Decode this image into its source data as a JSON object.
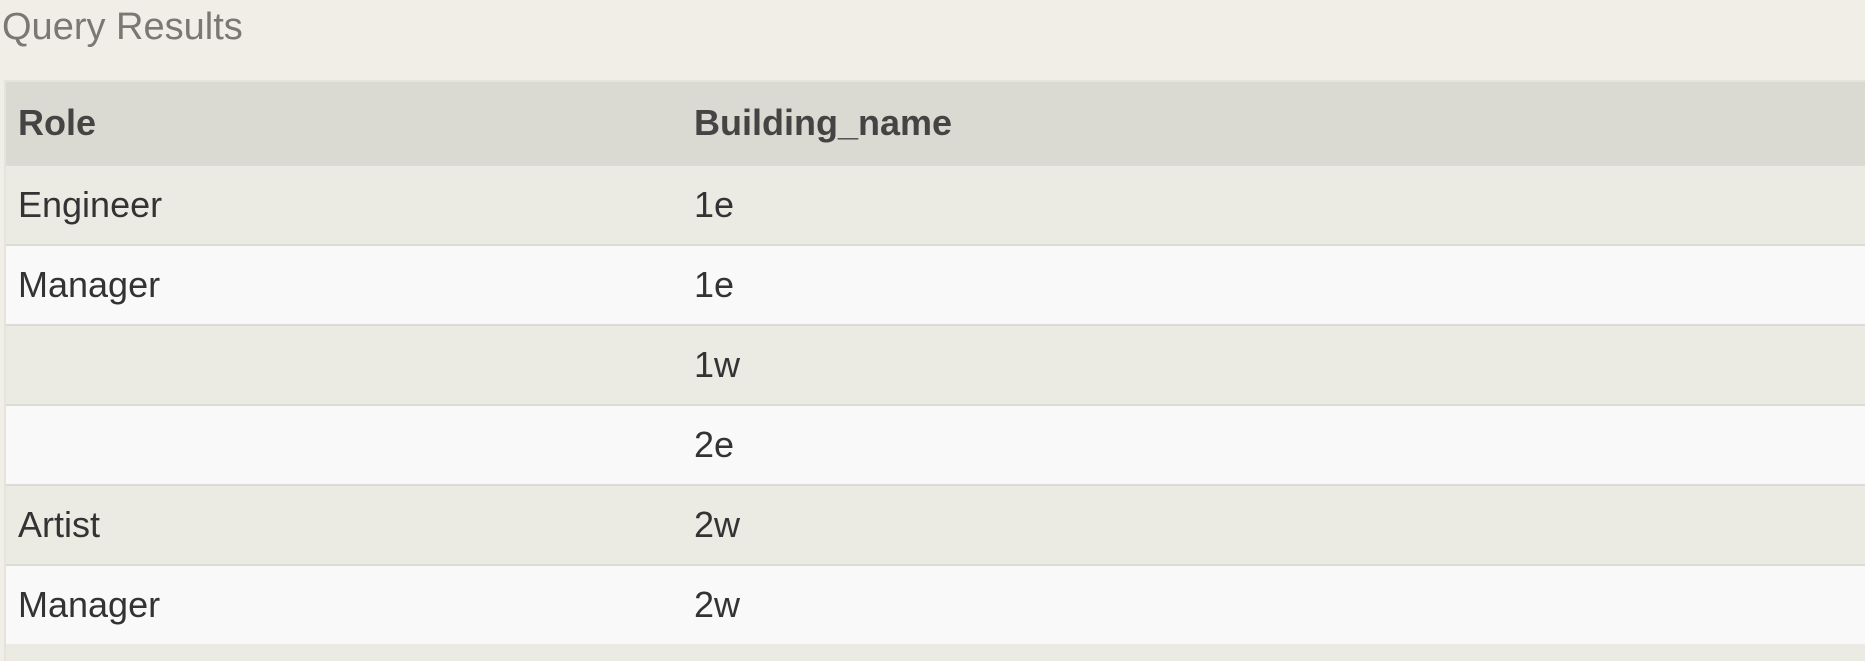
{
  "title": "Query Results",
  "table": {
    "columns": [
      "Role",
      "Building_name"
    ],
    "rows": [
      [
        "Engineer",
        "1e"
      ],
      [
        "Manager",
        "1e"
      ],
      [
        "",
        "1w"
      ],
      [
        "",
        "2e"
      ],
      [
        "Artist",
        "2w"
      ],
      [
        "Manager",
        "2w"
      ]
    ]
  }
}
